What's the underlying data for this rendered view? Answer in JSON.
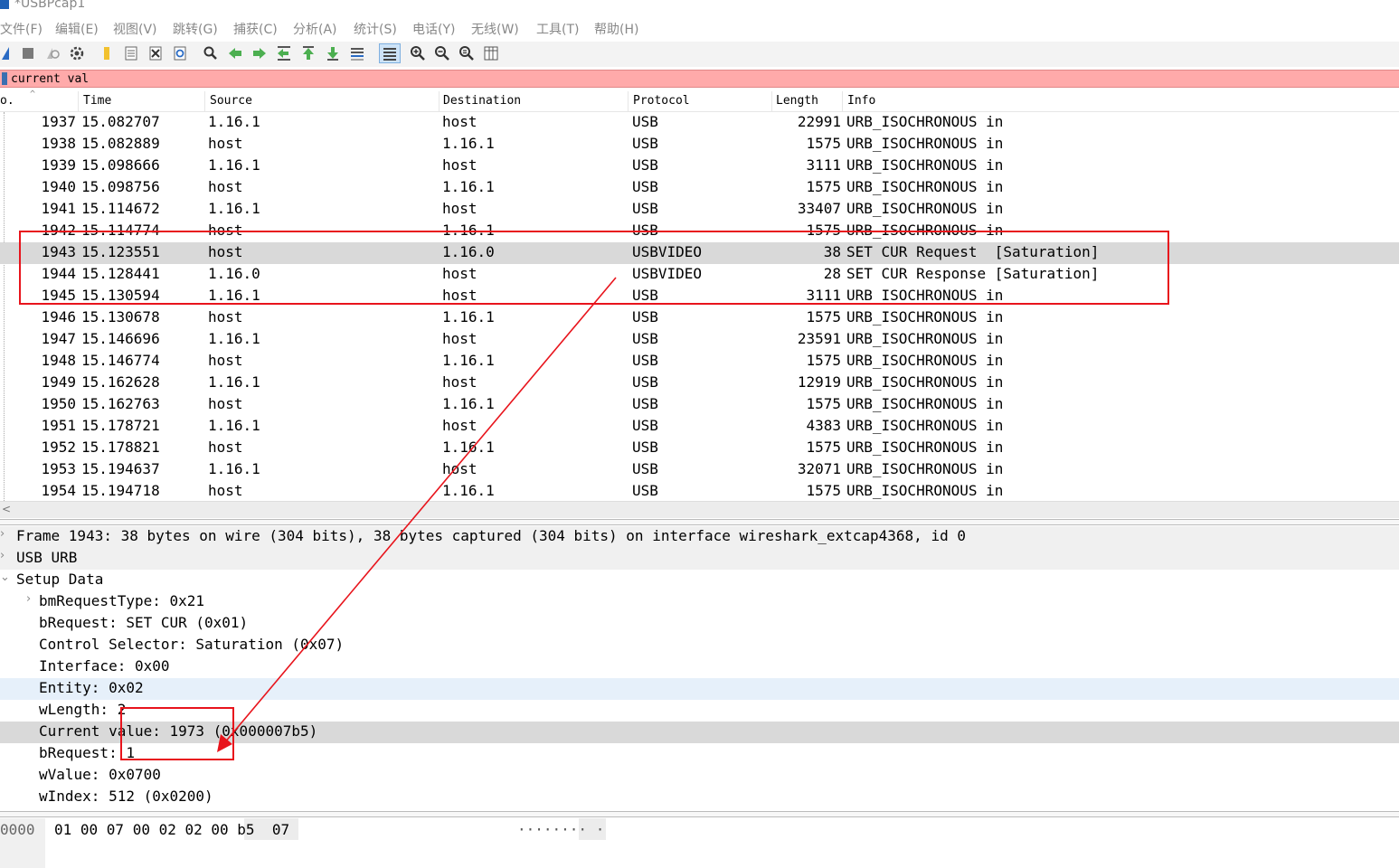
{
  "window": {
    "title": "*USBPcap1"
  },
  "menu": [
    "文件(F)",
    "编辑(E)",
    "视图(V)",
    "跳转(G)",
    "捕获(C)",
    "分析(A)",
    "统计(S)",
    "电话(Y)",
    "无线(W)",
    "工具(T)",
    "帮助(H)"
  ],
  "toolbar": {
    "icons": [
      "shark-fin-start-icon",
      "stop-icon",
      "restart-icon",
      "options-gear-icon",
      "open-folder-icon",
      "save-file-icon",
      "close-file-icon",
      "reload-icon",
      "find-packet-icon",
      "go-back-icon",
      "go-forward-icon",
      "go-to-packet-icon",
      "go-first-icon",
      "go-last-icon",
      "autoscroll-icon",
      "colorize-icon",
      "zoom-in-icon",
      "zoom-out-icon",
      "zoom-normal-icon",
      "resize-columns-icon"
    ]
  },
  "filter": {
    "value": "current val"
  },
  "packet_list": {
    "columns": [
      "o.",
      "Time",
      "Source",
      "Destination",
      "Protocol",
      "Length",
      "Info"
    ],
    "rows": [
      {
        "no": "1937",
        "time": "15.082707",
        "src": "1.16.1",
        "dst": "host",
        "proto": "USB",
        "len": "22991",
        "info": "URB_ISOCHRONOUS in"
      },
      {
        "no": "1938",
        "time": "15.082889",
        "src": "host",
        "dst": "1.16.1",
        "proto": "USB",
        "len": "1575",
        "info": "URB_ISOCHRONOUS in"
      },
      {
        "no": "1939",
        "time": "15.098666",
        "src": "1.16.1",
        "dst": "host",
        "proto": "USB",
        "len": "3111",
        "info": "URB_ISOCHRONOUS in"
      },
      {
        "no": "1940",
        "time": "15.098756",
        "src": "host",
        "dst": "1.16.1",
        "proto": "USB",
        "len": "1575",
        "info": "URB_ISOCHRONOUS in"
      },
      {
        "no": "1941",
        "time": "15.114672",
        "src": "1.16.1",
        "dst": "host",
        "proto": "USB",
        "len": "33407",
        "info": "URB_ISOCHRONOUS in"
      },
      {
        "no": "1942",
        "time": "15.114774",
        "src": "host",
        "dst": "1.16.1",
        "proto": "USB",
        "len": "1575",
        "info": "URB_ISOCHRONOUS in"
      },
      {
        "no": "1943",
        "time": "15.123551",
        "src": "host",
        "dst": "1.16.0",
        "proto": "USBVIDEO",
        "len": "38",
        "info": "SET CUR Request  [Saturation]",
        "selected": true
      },
      {
        "no": "1944",
        "time": "15.128441",
        "src": "1.16.0",
        "dst": "host",
        "proto": "USBVIDEO",
        "len": "28",
        "info": "SET CUR Response [Saturation]"
      },
      {
        "no": "1945",
        "time": "15.130594",
        "src": "1.16.1",
        "dst": "host",
        "proto": "USB",
        "len": "3111",
        "info": "URB_ISOCHRONOUS in"
      },
      {
        "no": "1946",
        "time": "15.130678",
        "src": "host",
        "dst": "1.16.1",
        "proto": "USB",
        "len": "1575",
        "info": "URB_ISOCHRONOUS in"
      },
      {
        "no": "1947",
        "time": "15.146696",
        "src": "1.16.1",
        "dst": "host",
        "proto": "USB",
        "len": "23591",
        "info": "URB_ISOCHRONOUS in"
      },
      {
        "no": "1948",
        "time": "15.146774",
        "src": "host",
        "dst": "1.16.1",
        "proto": "USB",
        "len": "1575",
        "info": "URB_ISOCHRONOUS in"
      },
      {
        "no": "1949",
        "time": "15.162628",
        "src": "1.16.1",
        "dst": "host",
        "proto": "USB",
        "len": "12919",
        "info": "URB_ISOCHRONOUS in"
      },
      {
        "no": "1950",
        "time": "15.162763",
        "src": "host",
        "dst": "1.16.1",
        "proto": "USB",
        "len": "1575",
        "info": "URB_ISOCHRONOUS in"
      },
      {
        "no": "1951",
        "time": "15.178721",
        "src": "1.16.1",
        "dst": "host",
        "proto": "USB",
        "len": "4383",
        "info": "URB_ISOCHRONOUS in"
      },
      {
        "no": "1952",
        "time": "15.178821",
        "src": "host",
        "dst": "1.16.1",
        "proto": "USB",
        "len": "1575",
        "info": "URB_ISOCHRONOUS in"
      },
      {
        "no": "1953",
        "time": "15.194637",
        "src": "1.16.1",
        "dst": "host",
        "proto": "USB",
        "len": "32071",
        "info": "URB_ISOCHRONOUS in"
      },
      {
        "no": "1954",
        "time": "15.194718",
        "src": "host",
        "dst": "1.16.1",
        "proto": "USB",
        "len": "1575",
        "info": "URB_ISOCHRONOUS in"
      }
    ]
  },
  "details": [
    {
      "text": "Frame 1943: 38 bytes on wire (304 bits), 38 bytes captured (304 bits) on interface wireshark_extcap4368, id 0",
      "indent": 0,
      "toggle": ">",
      "style": "gray"
    },
    {
      "text": "USB URB",
      "indent": 0,
      "toggle": ">",
      "style": "gray"
    },
    {
      "text": "Setup Data",
      "indent": 0,
      "toggle": "v",
      "style": ""
    },
    {
      "text": "bmRequestType: 0x21",
      "indent": 1,
      "toggle": ">",
      "style": ""
    },
    {
      "text": "bRequest: SET CUR (0x01)",
      "indent": 1,
      "toggle": "",
      "style": ""
    },
    {
      "text": "Control Selector: Saturation (0x07)",
      "indent": 1,
      "toggle": "",
      "style": ""
    },
    {
      "text": "Interface: 0x00",
      "indent": 1,
      "toggle": "",
      "style": ""
    },
    {
      "text": "Entity: 0x02",
      "indent": 1,
      "toggle": "",
      "style": "hl"
    },
    {
      "text": "wLength: 2",
      "indent": 1,
      "toggle": "",
      "style": ""
    },
    {
      "text": "Current value: 1973 (0x000007b5)",
      "indent": 1,
      "toggle": "",
      "style": "sel2"
    },
    {
      "text": "bRequest: 1",
      "indent": 1,
      "toggle": "",
      "style": ""
    },
    {
      "text": "wValue: 0x0700",
      "indent": 1,
      "toggle": "",
      "style": ""
    },
    {
      "text": "wIndex: 512 (0x0200)",
      "indent": 1,
      "toggle": "",
      "style": ""
    }
  ],
  "bytes": {
    "offset": "0000",
    "hex": "01 00 07 00 02 02 00 b5  07",
    "ascii": "········ ·"
  },
  "annotation_color": "#e8141c"
}
